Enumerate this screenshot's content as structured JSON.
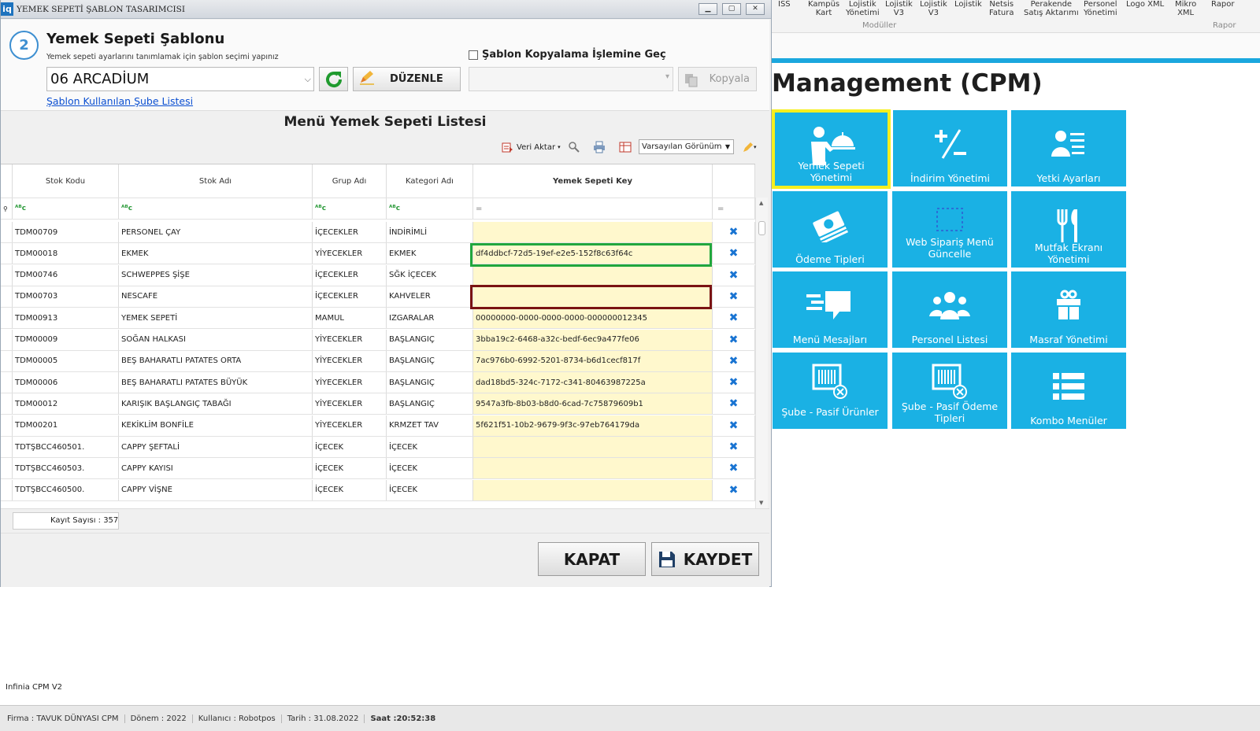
{
  "background": {
    "ribbon_items": [
      "ISS",
      "Kampüs\nKart",
      "Lojistik\nYönetimi",
      "Lojistik\nV3",
      "Lojistik\nV3",
      "Lojistik",
      "Netsis\nFatura",
      "Perakende\nSatış Aktarımı",
      "Personel\nYönetimi",
      "Logo XML",
      "Mikro\nXML",
      "Rapor"
    ],
    "ribbon_group_moduller": "Modüller",
    "ribbon_group_rapor": "Rapor",
    "title": "Management (CPM)",
    "tiles": [
      {
        "label": "Yemek Sepeti Yönetimi",
        "icon": "waiter-icon",
        "selected": true
      },
      {
        "label": "İndirim Yönetimi",
        "icon": "plus-minus-icon"
      },
      {
        "label": "Yetki Ayarları",
        "icon": "user-list-icon"
      },
      {
        "label": "Ödeme Tipleri",
        "icon": "money-icon"
      },
      {
        "label": "Web Sipariş Menü Güncelle",
        "icon": "web-order-icon"
      },
      {
        "label": "Mutfak Ekranı Yönetimi",
        "icon": "fork-knife-icon"
      },
      {
        "label": "Menü Mesajları",
        "icon": "message-icon"
      },
      {
        "label": "Personel Listesi",
        "icon": "people-icon"
      },
      {
        "label": "Masraf Yönetimi",
        "icon": "gift-icon"
      },
      {
        "label": "Şube - Pasif Ürünler",
        "icon": "barcode-cancel-icon"
      },
      {
        "label": "Şube - Pasif Ödeme Tipleri",
        "icon": "barcode-cancel-icon"
      },
      {
        "label": "Kombo Menüler",
        "icon": "list-icon"
      }
    ],
    "app_footer": "Infinia CPM V2",
    "status": {
      "firma": "Firma : TAVUK DÜNYASI CPM",
      "donem": "Dönem : 2022",
      "kullanici": "Kullanıcı : Robotpos",
      "tarih": "Tarih : 31.08.2022",
      "saat": "Saat :20:52:38"
    }
  },
  "dialog": {
    "window_title": "YEMEK SEPETİ ŞABLON TASARIMCISI",
    "app_icon_text": "iq",
    "step_number": "2",
    "header_title": "Yemek Sepeti Şablonu",
    "header_subtitle": "Yemek sepeti ayarlarını tanımlamak için şablon seçimi yapınız",
    "template_value": "06 ARCADİUM",
    "edit_button": "DÜZENLE",
    "branch_link": "Şablon Kullanılan Şube Listesi",
    "copy_checkbox_label": "Şablon Kopyalama İşlemine Geç",
    "copy_button": "Kopyala",
    "grid_title": "Menü Yemek Sepeti Listesi",
    "toolbar": {
      "export_label": "Veri Aktar",
      "view_value": "Varsayılan Görünüm"
    },
    "columns": [
      "Stok Kodu",
      "Stok Adı",
      "Grup Adı",
      "Kategori Adı",
      "Yemek Sepeti Key"
    ],
    "filter_placeholder": "ᴬᴮc",
    "filter_equals": "=",
    "rows": [
      {
        "code": "TDM00709",
        "name": "PERSONEL ÇAY",
        "group": "İÇECEKLER",
        "category": "İNDİRİMLİ",
        "key": ""
      },
      {
        "code": "TDM00018",
        "name": "EKMEK",
        "group": "YİYECEKLER",
        "category": "EKMEK",
        "key": "df4ddbcf-72d5-19ef-e2e5-152f8c63f64c"
      },
      {
        "code": "TDM00746",
        "name": "SCHWEPPES ŞİŞE",
        "group": "İÇECEKLER",
        "category": "SĞK İÇECEK",
        "key": ""
      },
      {
        "code": "TDM00703",
        "name": "NESCAFE",
        "group": "İÇECEKLER",
        "category": "KAHVELER",
        "key": ""
      },
      {
        "code": "TDM00913",
        "name": "YEMEK SEPETİ",
        "group": "MAMUL",
        "category": "IZGARALAR",
        "key": "00000000-0000-0000-0000-000000012345"
      },
      {
        "code": "TDM00009",
        "name": "SOĞAN HALKASI",
        "group": "YİYECEKLER",
        "category": "BAŞLANGIÇ",
        "key": "3bba19c2-6468-a32c-bedf-6ec9a477fe06"
      },
      {
        "code": "TDM00005",
        "name": "BEŞ BAHARATLI PATATES ORTA",
        "group": "YİYECEKLER",
        "category": "BAŞLANGIÇ",
        "key": "7ac976b0-6992-5201-8734-b6d1cecf817f"
      },
      {
        "code": "TDM00006",
        "name": "BEŞ BAHARATLI PATATES BÜYÜK",
        "group": "YİYECEKLER",
        "category": "BAŞLANGIÇ",
        "key": "dad18bd5-324c-7172-c341-80463987225a"
      },
      {
        "code": "TDM00012",
        "name": "KARIŞIK BAŞLANGIÇ TABAĞI",
        "group": "YİYECEKLER",
        "category": "BAŞLANGIÇ",
        "key": "9547a3fb-8b03-b8d0-6cad-7c75879609b1"
      },
      {
        "code": "TDM00201",
        "name": "KEKİKLİM BONFİLE",
        "group": "YİYECEKLER",
        "category": "KRMZET TAV",
        "key": "5f621f51-10b2-9679-9f3c-97eb764179da"
      },
      {
        "code": "TDTŞBCC460501.",
        "name": "CAPPY ŞEFTALİ",
        "group": "İÇECEK",
        "category": "İÇECEK",
        "key": ""
      },
      {
        "code": "TDTŞBCC460503.",
        "name": "CAPPY KAYISI",
        "group": "İÇECEK",
        "category": "İÇECEK",
        "key": ""
      },
      {
        "code": "TDTŞBCC460500.",
        "name": "CAPPY VİŞNE",
        "group": "İÇECEK",
        "category": "İÇECEK",
        "key": ""
      }
    ],
    "record_count": "Kayıt Sayısı : 357",
    "close_button": "KAPAT",
    "save_button": "KAYDET"
  }
}
